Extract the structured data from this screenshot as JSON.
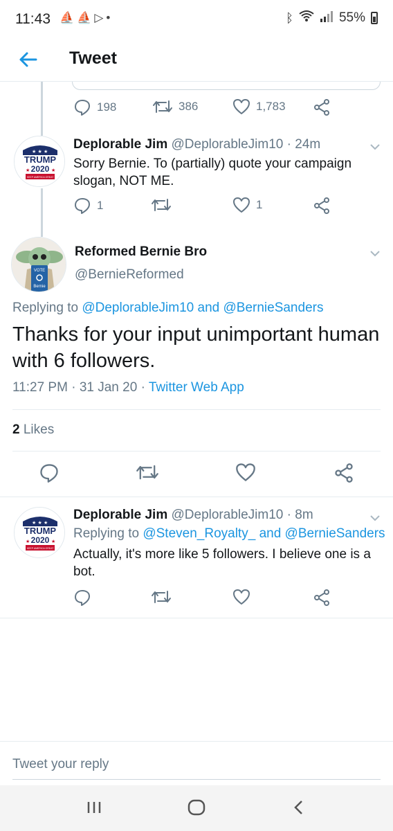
{
  "status_bar": {
    "time": "11:43",
    "notification_icons": [
      "boat-icon",
      "boat-icon",
      "play-store-icon",
      "dot-icon"
    ],
    "battery": "55%"
  },
  "app_bar": {
    "title": "Tweet"
  },
  "parent_tweet_actions": {
    "replies": "198",
    "retweets": "386",
    "likes": "1,783"
  },
  "reply_1": {
    "name": "Deplorable Jim",
    "handle": "@DeplorableJim10",
    "sep": "·",
    "age": "24m",
    "text": "Sorry Bernie. To (partially) quote your campaign slogan, NOT ME.",
    "replies": "1",
    "likes": "1",
    "avatar": {
      "top_text": "TRUMP",
      "year": "2020",
      "bottom_text": "KEEP AMERICA GREAT"
    }
  },
  "main_tweet": {
    "name": "Reformed Bernie Bro",
    "handle": "@BernieReformed",
    "replying_prefix": "Replying to",
    "replying_to_1": "@DeplorableJim10",
    "replying_and": "and",
    "replying_to_2": "@BernieSanders",
    "text": "Thanks for your input unimportant human with 6 followers.",
    "time": "11:27 PM",
    "date": "31 Jan 20",
    "source": "Twitter Web App",
    "likes_count": "2",
    "likes_label": "Likes",
    "avatar": {
      "vote": "VOTE",
      "name": "Bernie"
    }
  },
  "reply_2": {
    "name": "Deplorable Jim",
    "handle": "@DeplorableJim10",
    "sep": "·",
    "age": "8m",
    "replying_prefix": "Replying to",
    "replying_to_1": "@Steven_Royalty_",
    "replying_and": "and",
    "replying_to_2": "@BernieSanders",
    "text": "Actually, it's more like 5 followers. I believe one is a bot.",
    "avatar": {
      "top_text": "TRUMP",
      "year": "2020",
      "bottom_text": "KEEP AMERICA GREAT"
    }
  },
  "reply_box": {
    "placeholder": "Tweet your reply"
  },
  "colors": {
    "accent": "#1b95e0",
    "secondary_text": "#657786",
    "divider": "#e6ecf0"
  }
}
